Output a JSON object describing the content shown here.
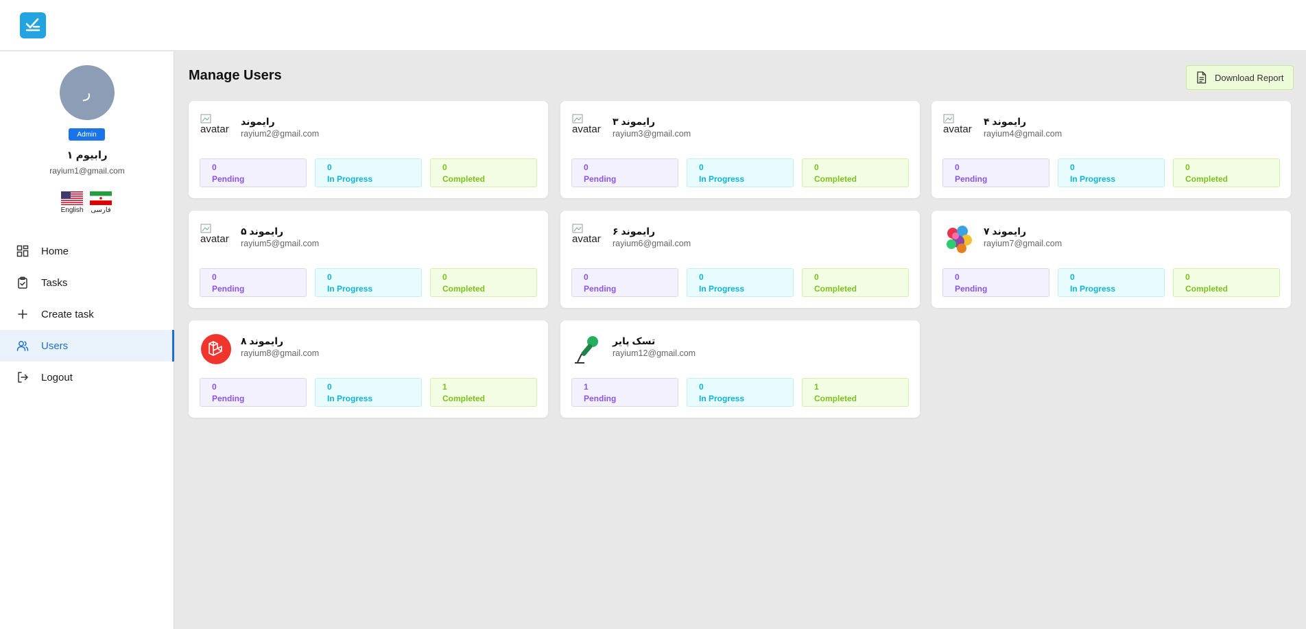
{
  "sidebar": {
    "avatar_initial": "ر",
    "role": "Admin",
    "name": "رابیوم ۱",
    "email": "rayium1@gmail.com",
    "languages": [
      {
        "label": "English",
        "flag": "us-flag-icon"
      },
      {
        "label": "فارسی",
        "flag": "iran-flag-icon"
      }
    ],
    "nav": [
      {
        "label": "Home",
        "icon": "dashboard-icon"
      },
      {
        "label": "Tasks",
        "icon": "clipboard-check-icon"
      },
      {
        "label": "Create task",
        "icon": "plus-icon"
      },
      {
        "label": "Users",
        "icon": "users-icon",
        "active": true
      },
      {
        "label": "Logout",
        "icon": "logout-icon"
      }
    ]
  },
  "main": {
    "title": "Manage Users",
    "download_label": "Download Report",
    "stat_labels": {
      "pending": "Pending",
      "in_progress": "In Progress",
      "completed": "Completed"
    },
    "users": [
      {
        "name": "رایموند",
        "email": "rayium2@gmail.com",
        "avatar": "broken",
        "avatar_alt": "avatar",
        "pending": "0",
        "in_progress": "0",
        "completed": "0"
      },
      {
        "name": "رایموند ۳",
        "email": "rayium3@gmail.com",
        "avatar": "broken",
        "avatar_alt": "avatar",
        "pending": "0",
        "in_progress": "0",
        "completed": "0"
      },
      {
        "name": "رایموند ۴",
        "email": "rayium4@gmail.com",
        "avatar": "broken",
        "avatar_alt": "avatar",
        "pending": "0",
        "in_progress": "0",
        "completed": "0"
      },
      {
        "name": "رایموند ۵",
        "email": "rayium5@gmail.com",
        "avatar": "broken",
        "avatar_alt": "avatar",
        "pending": "0",
        "in_progress": "0",
        "completed": "0"
      },
      {
        "name": "رایموند ۶",
        "email": "rayium6@gmail.com",
        "avatar": "broken",
        "avatar_alt": "avatar",
        "pending": "0",
        "in_progress": "0",
        "completed": "0"
      },
      {
        "name": "رایموند ۷",
        "email": "rayium7@gmail.com",
        "avatar": "colorful-balloons-image",
        "avatar_alt": "",
        "pending": "0",
        "in_progress": "0",
        "completed": "0"
      },
      {
        "name": "رایموند ۸",
        "email": "rayium8@gmail.com",
        "avatar": "laravel-logo-image",
        "avatar_alt": "",
        "pending": "0",
        "in_progress": "0",
        "completed": "1"
      },
      {
        "name": "تسک پایر",
        "email": "rayium12@gmail.com",
        "avatar": "green-microphone-image",
        "avatar_alt": "",
        "pending": "1",
        "in_progress": "0",
        "completed": "1"
      }
    ]
  },
  "colors": {
    "brand": "#22a4e0",
    "accent": "#1a6fd6",
    "pending": "#8a54e0",
    "in_progress": "#0db3d3",
    "completed": "#7cc01c"
  }
}
